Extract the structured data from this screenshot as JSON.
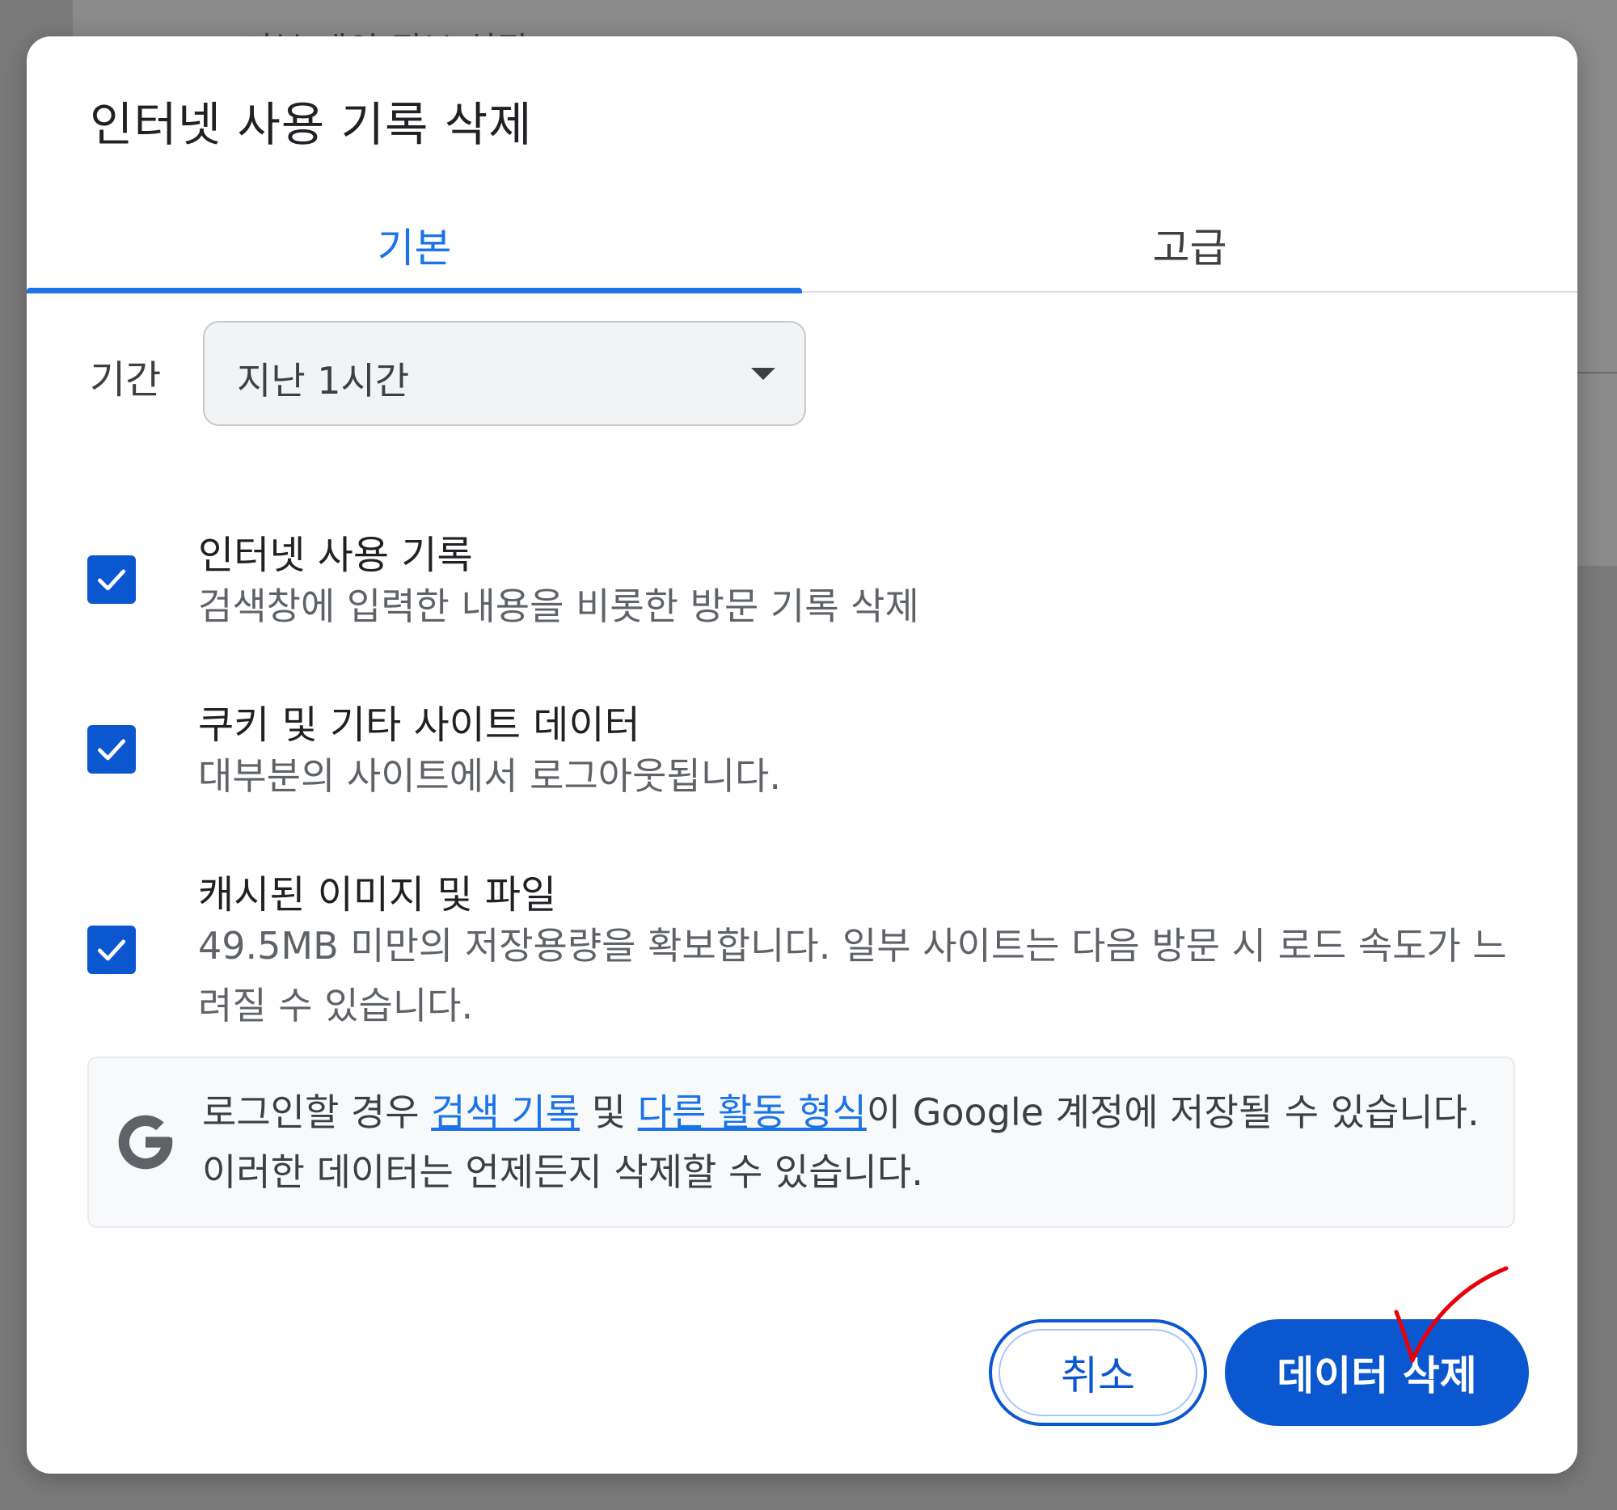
{
  "background": {
    "peek_text": "기본 개인 정보 설정"
  },
  "dialog": {
    "title": "인터넷 사용 기록 삭제",
    "tabs": [
      {
        "label": "기본",
        "selected": true
      },
      {
        "label": "고급",
        "selected": false
      }
    ],
    "period": {
      "label": "기간",
      "value": "지난 1시간"
    },
    "options": [
      {
        "title": "인터넷 사용 기록",
        "description": "검색창에 입력한 내용을 비롯한 방문 기록 삭제",
        "checked": true
      },
      {
        "title": "쿠키 및 기타 사이트 데이터",
        "description": "대부분의 사이트에서 로그아웃됩니다.",
        "checked": true
      },
      {
        "title": "캐시된 이미지 및 파일",
        "description": "49.5MB 미만의 저장용량을 확보합니다. 일부 사이트는 다음 방문 시 로드 속도가 느려질 수 있습니다.",
        "checked": true
      }
    ],
    "info": {
      "icon": "google-g-icon",
      "text_before": "로그인할 경우 ",
      "link1": "검색 기록",
      "text_middle": " 및 ",
      "link2": "다른 활동 형식",
      "text_after": "이 Google 계정에 저장될 수 있습니다. 이러한 데이터는 언제든지 삭제할 수 있습니다."
    },
    "buttons": {
      "cancel": "취소",
      "delete": "데이터 삭제"
    }
  },
  "colors": {
    "accent": "#1a73e8",
    "primary_button": "#0b57d0",
    "annotation": "#e8000b"
  }
}
